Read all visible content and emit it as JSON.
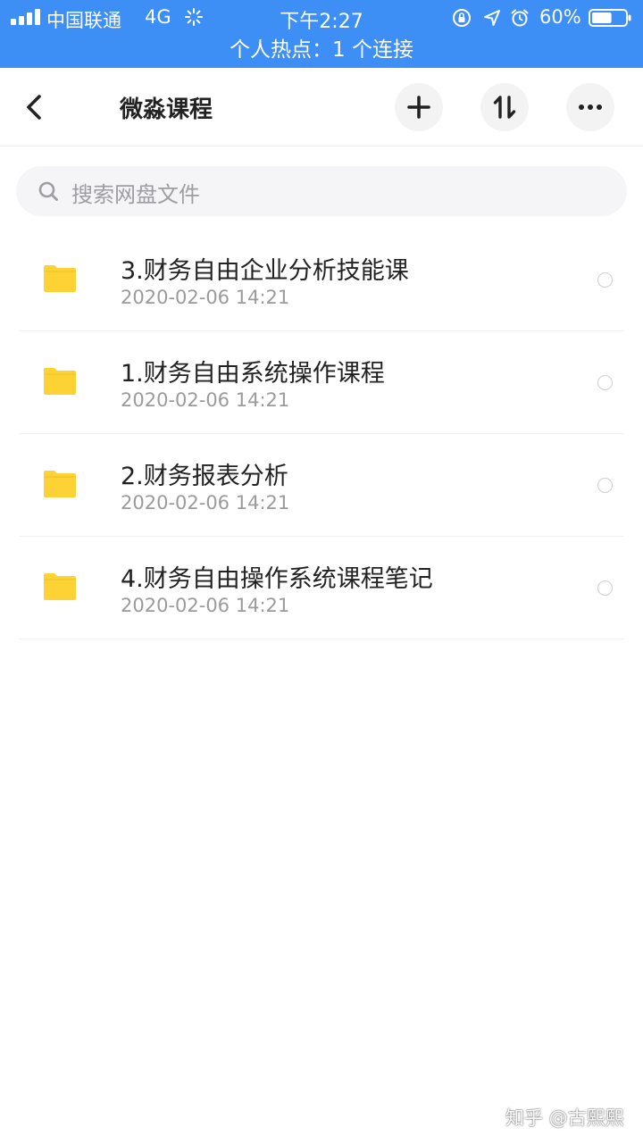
{
  "status_bar": {
    "carrier": "中国联通",
    "network": "4G",
    "time": "下午2:27",
    "battery": "60%",
    "hotspot_banner": "个人热点：1 个连接",
    "icons": [
      "signal-icon",
      "loading-icon",
      "rotation-lock-icon",
      "location-icon",
      "alarm-icon",
      "battery-icon"
    ],
    "color": "#3d8ef5",
    "battery_level": 0.6
  },
  "nav": {
    "title": "微淼课程",
    "icons": [
      "back-icon",
      "plus-icon",
      "sort-icon",
      "more-icon"
    ]
  },
  "search": {
    "placeholder": "搜索网盘文件"
  },
  "files": [
    {
      "name": "3.财务自由企业分析技能课",
      "date": "2020-02-06 14:21",
      "icon": "folder-icon"
    },
    {
      "name": "1.财务自由系统操作课程",
      "date": "2020-02-06 14:21",
      "icon": "folder-icon"
    },
    {
      "name": "2.财务报表分析",
      "date": "2020-02-06 14:21",
      "icon": "folder-icon"
    },
    {
      "name": "4.财务自由操作系统课程笔记",
      "date": "2020-02-06 14:21",
      "icon": "folder-icon"
    }
  ],
  "folder_color": "#fcd234",
  "watermark": "知乎 @古熙熙"
}
